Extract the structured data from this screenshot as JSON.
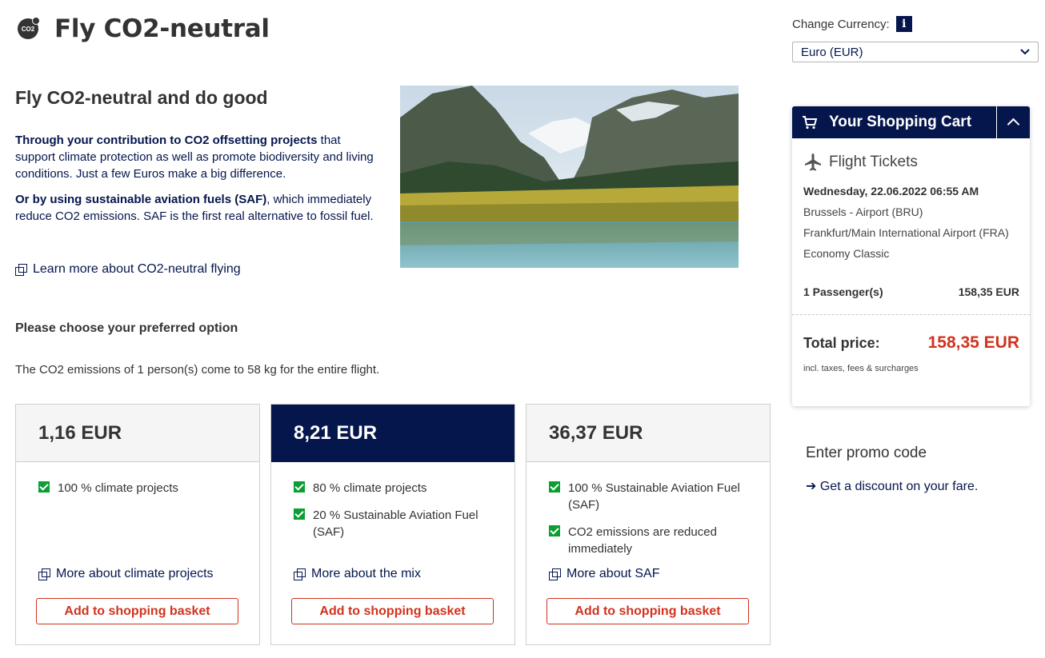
{
  "header": {
    "title": "Fly CO2-neutral",
    "logo_text": "CO2"
  },
  "currency": {
    "label": "Change Currency:",
    "info": "i",
    "selected": "Euro (EUR)"
  },
  "intro": {
    "title": "Fly CO2-neutral and do good",
    "p1_bold": "Through your contribution to CO2 offsetting projects",
    "p1_rest": " that support climate protection as well as promote biodiversity and living conditions. Just a few Euros make a big difference.",
    "p2_bold": "Or by using sustainable aviation fuels (SAF)",
    "p2_rest": ", which immediately reduce CO2 emissions. SAF is the first real alternative to fossil fuel.",
    "learn_more": "Learn more about CO2-neutral flying"
  },
  "options": {
    "choose_label": "Please choose your preferred option",
    "emissions_text": "The CO2 emissions of 1 person(s) come to 58 kg for the entire flight.",
    "basket_label": "Add to shopping basket",
    "cards": [
      {
        "price": "1,16 EUR",
        "features": [
          "100 % climate projects"
        ],
        "more": "More about climate projects"
      },
      {
        "price": "8,21 EUR",
        "features": [
          "80 % climate projects",
          "20 % Sustainable Aviation Fuel (SAF)"
        ],
        "more": "More about the mix"
      },
      {
        "price": "36,37 EUR",
        "features": [
          "100 % Sustainable Aviation Fuel (SAF)",
          "CO2 emissions are reduced immediately"
        ],
        "more": "More about SAF"
      }
    ]
  },
  "cart": {
    "title": "Your Shopping Cart",
    "section_title": "Flight Tickets",
    "date": "Wednesday, 22.06.2022 06:55 AM",
    "origin": "Brussels - Airport (BRU)",
    "destination": "Frankfurt/Main International Airport (FRA)",
    "cabin": "Economy Classic",
    "passengers": "1 Passenger(s)",
    "passenger_price": "158,35 EUR",
    "total_label": "Total price:",
    "total_value": "158,35 EUR",
    "total_note": "incl. taxes, fees & surcharges"
  },
  "promo": {
    "title": "Enter promo code",
    "link": "Get a discount on your fare."
  },
  "colors": {
    "brand_navy": "#05164d",
    "accent_red": "#d2321e",
    "check_green": "#0b9e32"
  }
}
